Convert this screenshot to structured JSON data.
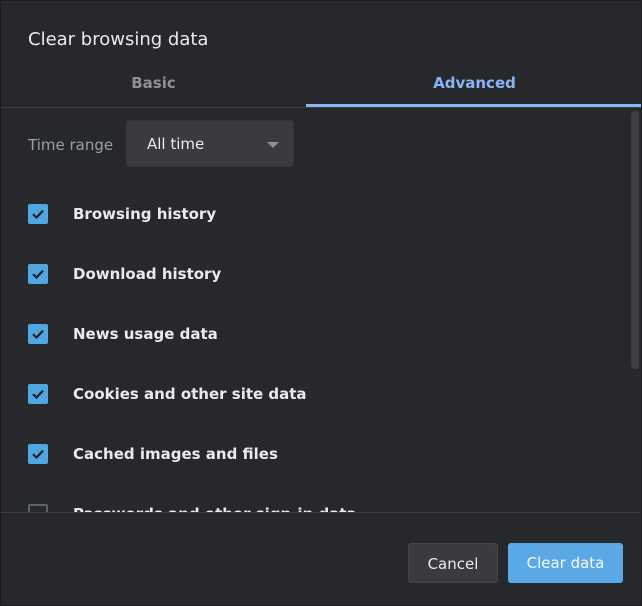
{
  "dialog": {
    "title": "Clear browsing data"
  },
  "tabs": [
    {
      "label": "Basic",
      "active": false
    },
    {
      "label": "Advanced",
      "active": true
    }
  ],
  "time_range": {
    "label": "Time range",
    "selected": "All time"
  },
  "items": [
    {
      "label": "Browsing history",
      "checked": true
    },
    {
      "label": "Download history",
      "checked": true
    },
    {
      "label": "News usage data",
      "checked": true
    },
    {
      "label": "Cookies and other site data",
      "checked": true
    },
    {
      "label": "Cached images and files",
      "checked": true
    },
    {
      "label": "Passwords and other sign-in data",
      "checked": false
    }
  ],
  "buttons": {
    "cancel": "Cancel",
    "clear": "Clear data"
  },
  "colors": {
    "accent": "#8ab4f8",
    "checkbox": "#4fa6e0",
    "primary_button": "#5aa9e6",
    "background": "#27282c"
  }
}
